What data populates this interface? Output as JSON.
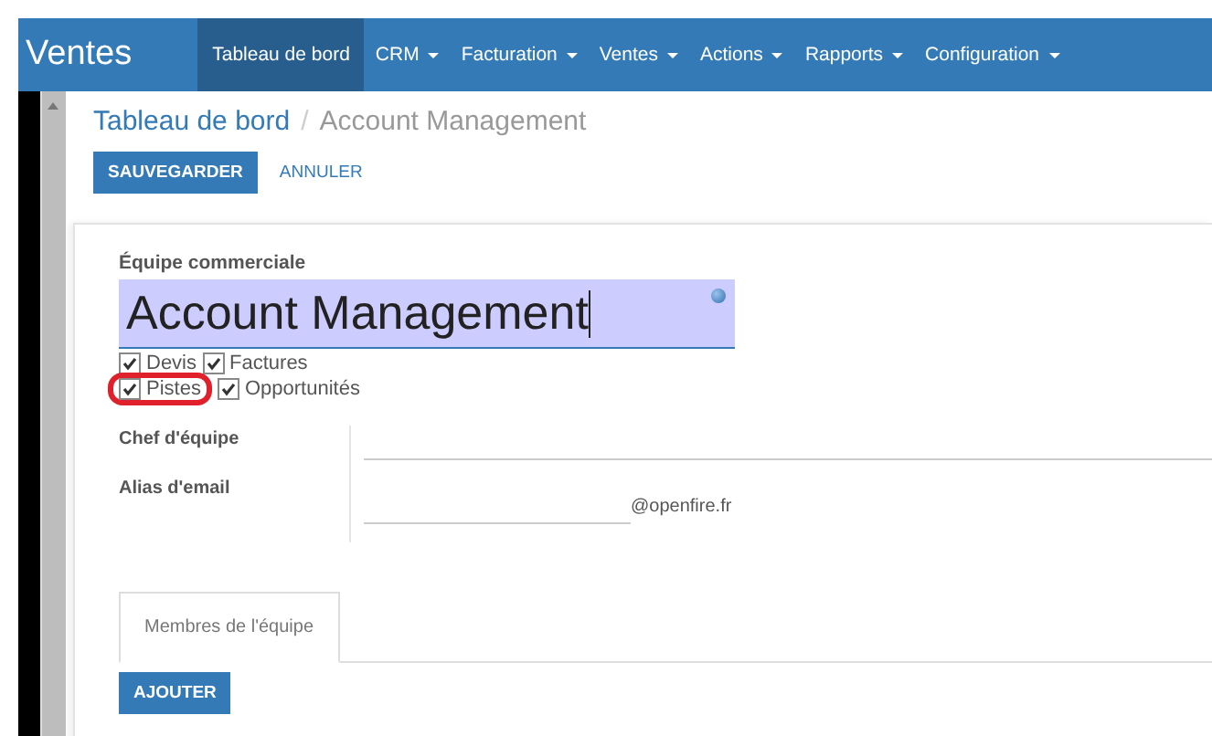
{
  "navbar": {
    "brand": "Ventes",
    "menus": [
      {
        "label": "Tableau de bord",
        "selected": true,
        "dropdown": false
      },
      {
        "label": "CRM",
        "selected": false,
        "dropdown": true
      },
      {
        "label": "Facturation",
        "selected": false,
        "dropdown": true
      },
      {
        "label": "Ventes",
        "selected": false,
        "dropdown": true
      },
      {
        "label": "Actions",
        "selected": false,
        "dropdown": true
      },
      {
        "label": "Rapports",
        "selected": false,
        "dropdown": true
      },
      {
        "label": "Configuration",
        "selected": false,
        "dropdown": true
      }
    ]
  },
  "breadcrumb": {
    "parent": "Tableau de bord",
    "separator": "/",
    "current": "Account Management"
  },
  "buttons": {
    "save": "SAUVEGARDER",
    "cancel": "ANNULER"
  },
  "form": {
    "name_label": "Équipe commerciale",
    "name_value": "Account Management",
    "checkbox_rows": [
      [
        {
          "label": "Devis",
          "checked": true,
          "highlighted": false
        },
        {
          "label": "Factures",
          "checked": true,
          "highlighted": false
        }
      ],
      [
        {
          "label": "Pistes",
          "checked": true,
          "highlighted": true
        },
        {
          "label": "Opportunités",
          "checked": true,
          "highlighted": false
        }
      ]
    ],
    "fields": [
      {
        "label": "Chef d'équipe"
      },
      {
        "label": "Alias d'email",
        "suffix": "@openfire.fr"
      }
    ],
    "tabs": [
      {
        "label": "Membres de l'équipe",
        "selected": true
      }
    ],
    "add_button": "AJOUTER"
  }
}
